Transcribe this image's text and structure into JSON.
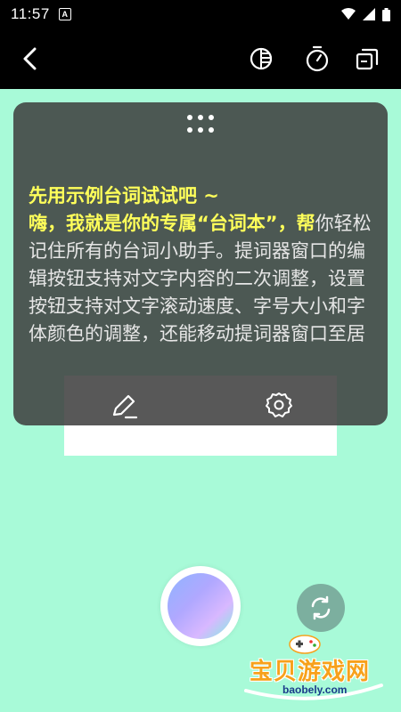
{
  "status_bar": {
    "time": "11:57",
    "notification_badge": "A",
    "icons": [
      "wifi-icon",
      "cellular-signal-icon",
      "battery-icon"
    ]
  },
  "app_bar": {
    "icons": [
      "back-arrow-icon",
      "contrast-icon",
      "timer-icon",
      "copy-windows-icon"
    ]
  },
  "teleprompter": {
    "highlight_line_1": "先用示例台词试试吧 ~",
    "highlight_line_2": "嗨，我就是你的专属“台词本”，帮",
    "body_text": "你轻松记住所有的台词小助手。提词器窗口的编辑按钮支持对文字内容的二次调整，设置按钮支持对文字滚动速度、字号大小和字体颜色的调整，还能移动提词器窗口至居",
    "icons": [
      "drag-handle-icon",
      "edit-pencil-icon",
      "settings-gear-icon"
    ]
  },
  "controls": {
    "icons": [
      "record-button-icon",
      "flip-camera-icon"
    ]
  },
  "watermark": {
    "title": "宝贝游戏网",
    "url": "baobely.com"
  },
  "colors": {
    "background": "#a8fad8",
    "highlight_text": "#ffff5a",
    "panel": "#3c3c3c",
    "watermark_orange": "#f7a11b"
  }
}
